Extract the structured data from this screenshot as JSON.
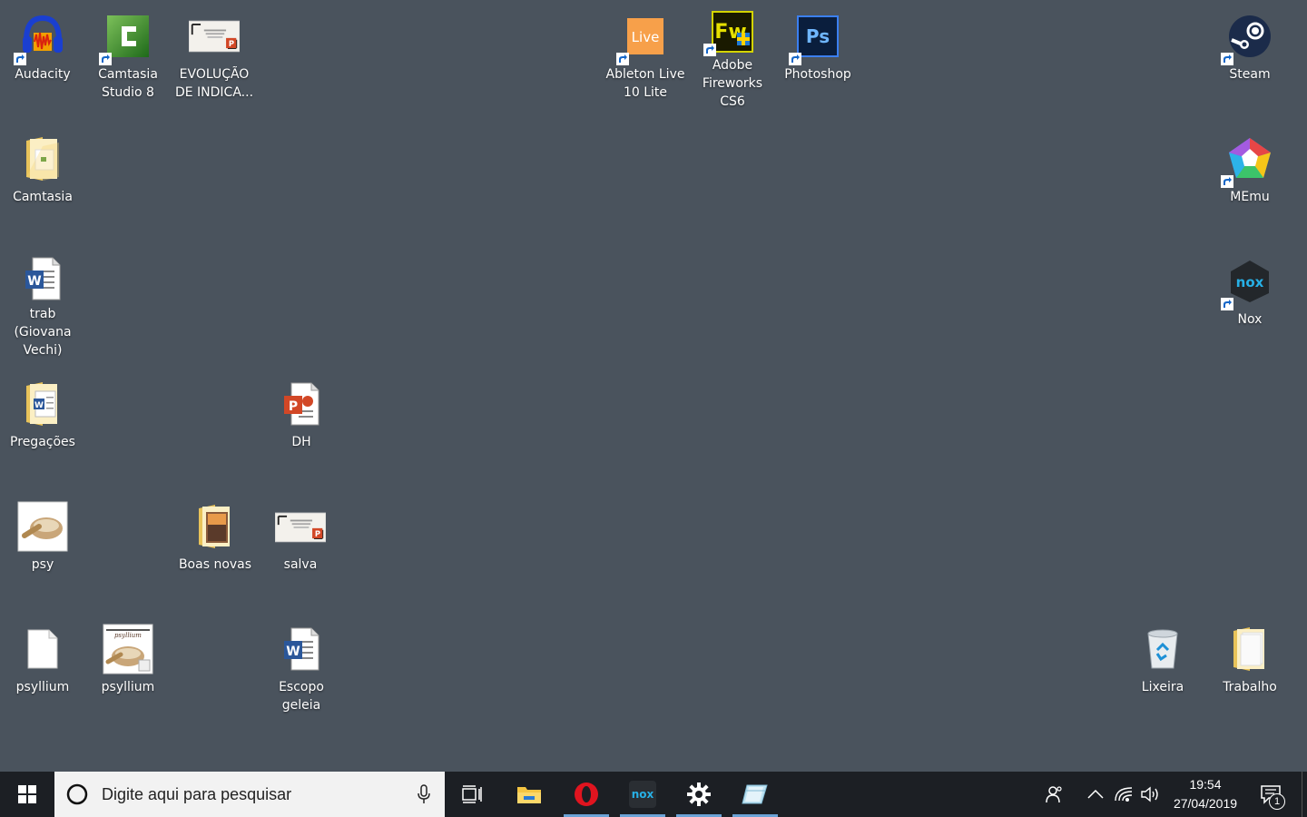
{
  "desktop_icons": {
    "audacity": "Audacity",
    "camtasia_studio": "Camtasia Studio 8",
    "evolucao": "EVOLUÇÃO DE INDICA...",
    "ableton": "Ableton Live 10 Lite",
    "fireworks": "Adobe Fireworks CS6",
    "photoshop": "Photoshop",
    "steam": "Steam",
    "camtasia_folder": "Camtasia",
    "memu": "MEmu",
    "trab": "trab (Giovana Vechi)",
    "nox": "Nox",
    "pregacoes": "Pregações",
    "dh": "DH",
    "psy": "psy",
    "boas_novas": "Boas novas",
    "salva": "salva",
    "psyllium_file": "psyllium",
    "psyllium_img": "psyllium",
    "escopo": "Escopo geleia",
    "lixeira": "Lixeira",
    "trabalho": "Trabalho"
  },
  "icon_glyphs": {
    "ableton": "Live",
    "fireworks": "Fw",
    "photoshop": "Ps",
    "nox": "nox",
    "word": "W",
    "ppt": "P",
    "psyllium_thumb": "psyllium"
  },
  "taskbar": {
    "search_placeholder": "Digite aqui para pesquisar",
    "time": "19:54",
    "date": "27/04/2019",
    "notification_count": "1",
    "nox_label": "nox"
  },
  "colors": {
    "desktop_bg": "#4a535d",
    "taskbar_bg": "#1c1f24",
    "running_indicator": "#6ba3d6"
  }
}
